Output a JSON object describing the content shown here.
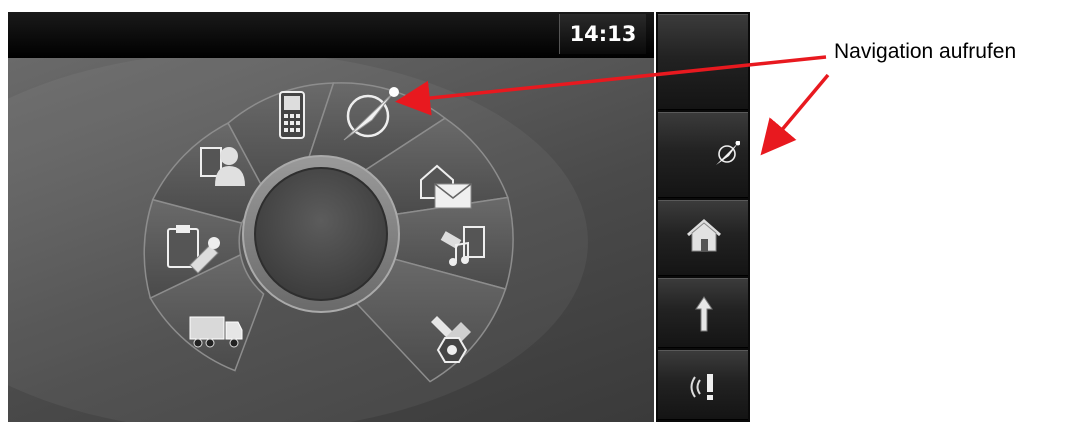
{
  "status_bar": {
    "time": "14:13"
  },
  "annotation": {
    "label": "Navigation aufrufen",
    "arrow_color": "#e8191f"
  },
  "menu_wheel": {
    "items": [
      {
        "id": "truck",
        "icon": "truck-icon"
      },
      {
        "id": "order",
        "icon": "clipboard-stamp-icon"
      },
      {
        "id": "driver",
        "icon": "driver-card-icon"
      },
      {
        "id": "phone",
        "icon": "mobile-phone-icon"
      },
      {
        "id": "navigation",
        "icon": "navigation-compass-icon"
      },
      {
        "id": "messages",
        "icon": "messages-envelope-icon"
      },
      {
        "id": "media",
        "icon": "media-music-icon"
      },
      {
        "id": "settings",
        "icon": "settings-tools-icon"
      }
    ],
    "center": {
      "icon": "center-knob"
    }
  },
  "sidebar": {
    "buttons": [
      {
        "id": "empty",
        "icon": ""
      },
      {
        "id": "navigation",
        "icon": "navigation-compass-icon"
      },
      {
        "id": "home",
        "icon": "home-icon"
      },
      {
        "id": "up",
        "icon": "arrow-up-icon"
      },
      {
        "id": "alert",
        "icon": "warning-signal-icon"
      }
    ]
  }
}
